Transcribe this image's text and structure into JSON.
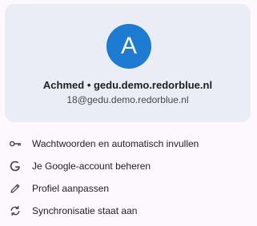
{
  "profile": {
    "avatar_letter": "A",
    "avatar_color": "#1d7bd1",
    "name": "Achmed • gedu.demo.redorblue.nl",
    "email": "18@gedu.demo.redorblue.nl"
  },
  "menu": {
    "items": [
      {
        "icon": "key-icon",
        "label": "Wachtwoorden en automatisch invullen"
      },
      {
        "icon": "google-g-icon",
        "label": "Je Google-account beheren"
      },
      {
        "icon": "pencil-icon",
        "label": "Profiel aanpassen"
      },
      {
        "icon": "sync-icon",
        "label": "Synchronisatie staat aan"
      }
    ]
  }
}
